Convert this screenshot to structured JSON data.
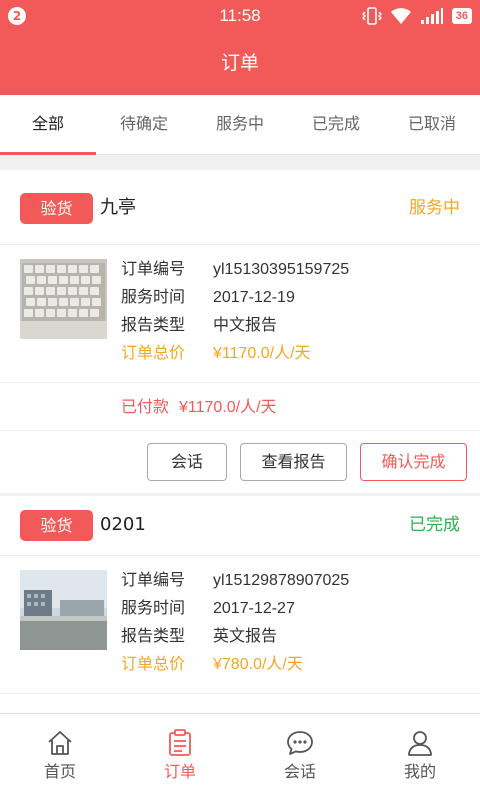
{
  "status_bar": {
    "notification_count": "2",
    "time": "11:58",
    "battery": "36"
  },
  "header": {
    "title": "订单"
  },
  "tabs": [
    {
      "label": "全部",
      "active": true
    },
    {
      "label": "待确定",
      "active": false
    },
    {
      "label": "服务中",
      "active": false
    },
    {
      "label": "已完成",
      "active": false
    },
    {
      "label": "已取消",
      "active": false
    }
  ],
  "orders": [
    {
      "type": "验货",
      "name": "九亭",
      "status": "服务中",
      "status_color": "#f5a623",
      "thumbnail": "keyboard-photo",
      "order_no_label": "订单编号",
      "order_no": "yl15130395159725",
      "service_time_label": "服务时间",
      "service_time": "2017-12-19",
      "report_type_label": "报告类型",
      "report_type": "中文报告",
      "total_label": "订单总价",
      "total": "¥1170.0/人/天",
      "paid_label": "已付款",
      "paid": "¥1170.0/人/天",
      "actions": {
        "chat": "会话",
        "view_report": "查看报告",
        "confirm": "确认完成"
      }
    },
    {
      "type": "验货",
      "name": "0201",
      "status": "已完成",
      "status_color": "#2bb24c",
      "thumbnail": "factory-photo",
      "order_no_label": "订单编号",
      "order_no": "yl15129878907025",
      "service_time_label": "服务时间",
      "service_time": "2017-12-27",
      "report_type_label": "报告类型",
      "report_type": "英文报告",
      "total_label": "订单总价",
      "total": "¥780.0/人/天"
    }
  ],
  "bottom_nav": [
    {
      "label": "首页",
      "icon": "home-icon",
      "active": false
    },
    {
      "label": "订单",
      "icon": "orders-icon",
      "active": true
    },
    {
      "label": "会话",
      "icon": "chat-icon",
      "active": false
    },
    {
      "label": "我的",
      "icon": "profile-icon",
      "active": false
    }
  ],
  "colors": {
    "brand": "#f25a5a",
    "price": "#f5a623",
    "completed": "#2bb24c"
  }
}
